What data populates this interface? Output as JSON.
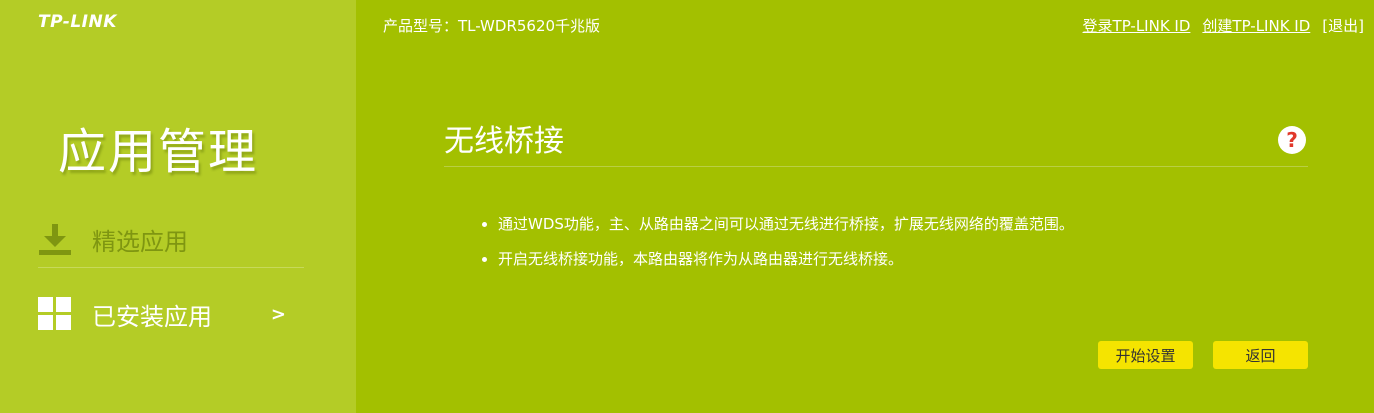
{
  "brand": {
    "logo_text": "TP-LINK"
  },
  "header": {
    "model_label": "产品型号：TL-WDR5620千兆版",
    "login_link": "登录TP-LINK ID",
    "create_link": "创建TP-LINK ID",
    "logout_link": "[退出]"
  },
  "sidebar": {
    "title": "应用管理",
    "items": [
      {
        "label": "精选应用",
        "icon": "download-icon",
        "active": false
      },
      {
        "label": "已安装应用",
        "icon": "grid-icon",
        "active": true,
        "arrow": ">"
      }
    ]
  },
  "main": {
    "title": "无线桥接",
    "help_icon": "?",
    "bullets": [
      "通过WDS功能，主、从路由器之间可以通过无线进行桥接，扩展无线网络的覆盖范围。",
      "开启无线桥接功能，本路由器将作为从路由器进行无线桥接。"
    ],
    "buttons": {
      "start_label": "开始设置",
      "back_label": "返回"
    }
  },
  "colors": {
    "background": "#a3c000",
    "sidebar": "#b4cc26",
    "button": "#f5e400",
    "help_mark": "#e1382c"
  }
}
